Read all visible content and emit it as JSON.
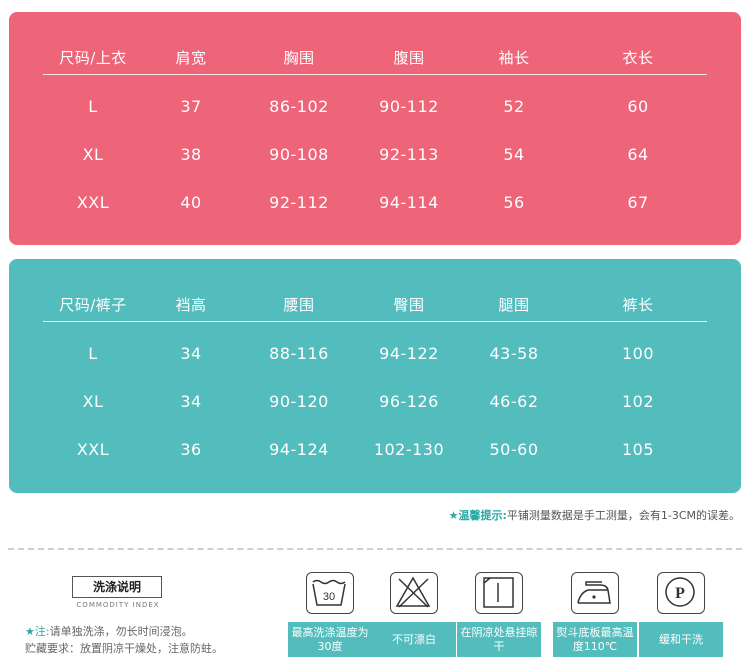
{
  "top_table": {
    "headers": [
      "尺码/上衣",
      "肩宽",
      "胸围",
      "腹围",
      "袖长",
      "衣长"
    ],
    "rows": [
      [
        "L",
        "37",
        "86-102",
        "90-112",
        "52",
        "60"
      ],
      [
        "XL",
        "38",
        "90-108",
        "92-113",
        "54",
        "64"
      ],
      [
        "XXL",
        "40",
        "92-112",
        "94-114",
        "56",
        "67"
      ]
    ]
  },
  "bottom_table": {
    "headers": [
      "尺码/裤子",
      "裆高",
      "腰围",
      "臀围",
      "腿围",
      "裤长"
    ],
    "rows": [
      [
        "L",
        "34",
        "88-116",
        "94-122",
        "43-58",
        "100"
      ],
      [
        "XL",
        "34",
        "90-120",
        "96-126",
        "46-62",
        "102"
      ],
      [
        "XXL",
        "36",
        "94-124",
        "102-130",
        "50-60",
        "105"
      ]
    ]
  },
  "tip": {
    "star": "★",
    "label": "温馨提示:",
    "text": "平铺测量数据是手工测量，会有1-3CM的误差。"
  },
  "care": {
    "title": "洗涤说明",
    "subtitle": "COMMODITY INDEX",
    "note1_star": "★",
    "note1_label": "注:",
    "note1_text": "请单独洗涤，勿长时间浸泡。",
    "note2_text": "贮藏要求：放置阴凉干燥处，注意防蛀。",
    "icons": [
      {
        "icon": "wash-30-icon",
        "tub_text": "30",
        "caption": "最高洗涤温度为30度"
      },
      {
        "icon": "no-bleach-icon",
        "caption": "不可漂白"
      },
      {
        "icon": "hang-dry-icon",
        "caption": "在阴凉处悬挂晾干"
      },
      {
        "icon": "iron-icon",
        "caption": "熨斗底板最高温度110℃"
      },
      {
        "icon": "dry-clean-icon",
        "symbol": "P",
        "caption": "缓和干洗"
      }
    ]
  },
  "colors": {
    "top_panel": "#ee6478",
    "bottom_panel": "#53bcbd",
    "accent": "#2aa8a4"
  }
}
